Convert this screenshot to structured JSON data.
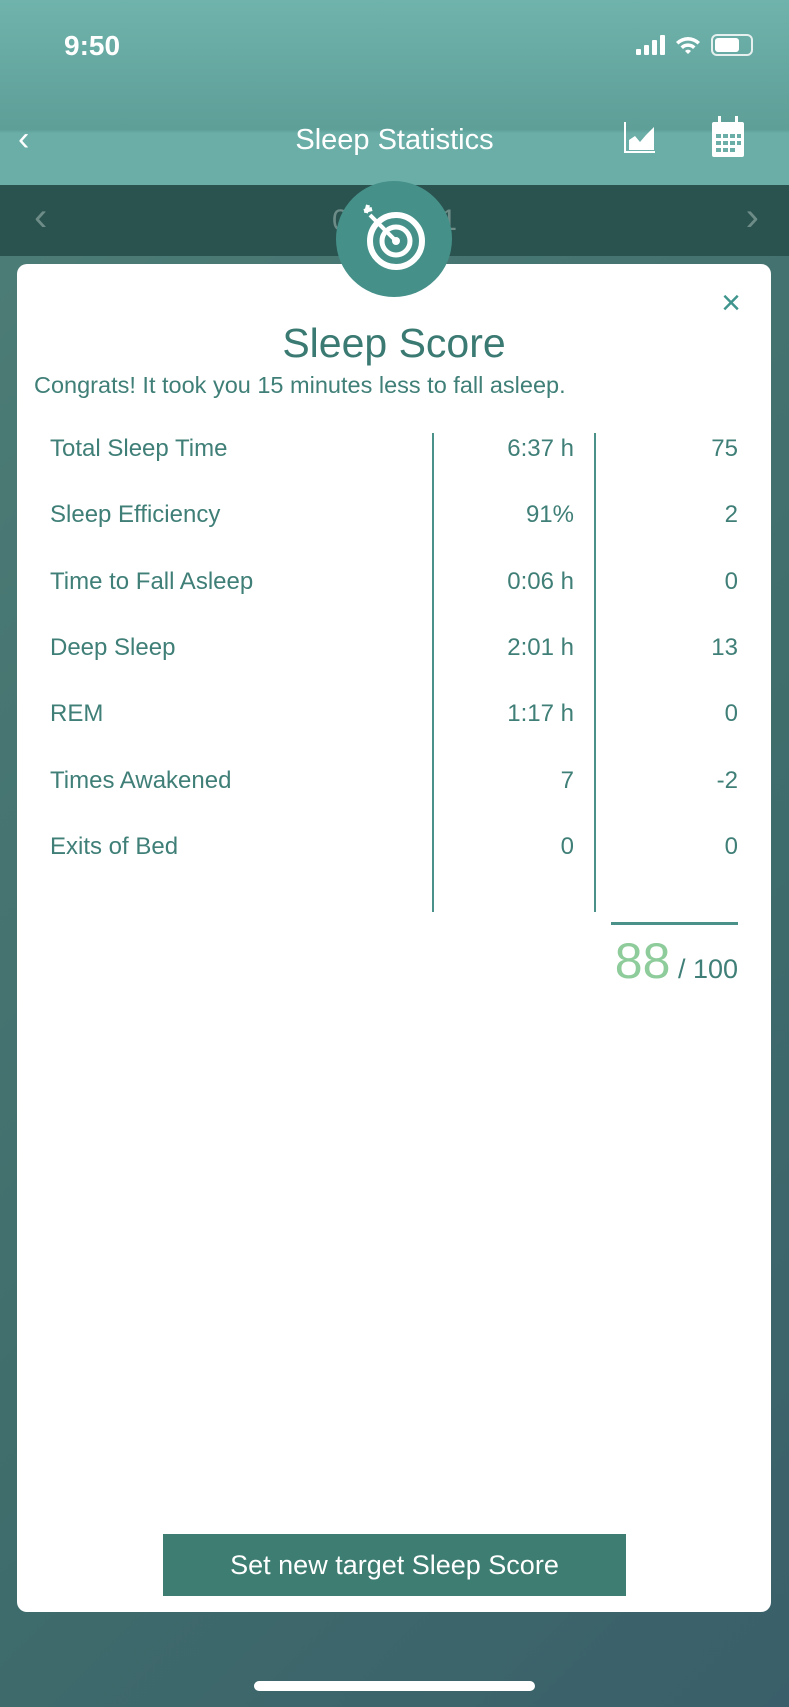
{
  "status_bar": {
    "time": "9:50"
  },
  "nav": {
    "title": "Sleep Statistics",
    "back_icon": "chevron-left",
    "chart_icon": "bar-chart",
    "calendar_icon": "calendar"
  },
  "date_bar": {
    "date": "06/  /2021"
  },
  "modal": {
    "icon": "target-dart",
    "title": "Sleep Score",
    "message": "Congrats! It took you 15 minutes less to fall asleep.",
    "rows": [
      {
        "label": "Total Sleep Time",
        "value": "6:37 h",
        "points": "75"
      },
      {
        "label": "Sleep Efficiency",
        "value": "91%",
        "points": "2"
      },
      {
        "label": "Time to Fall Asleep",
        "value": "0:06 h",
        "points": "0"
      },
      {
        "label": "Deep Sleep",
        "value": "2:01 h",
        "points": "13"
      },
      {
        "label": "REM",
        "value": "1:17 h",
        "points": "0"
      },
      {
        "label": "Times Awakened",
        "value": "7",
        "points": "-2"
      },
      {
        "label": "Exits of Bed",
        "value": "0",
        "points": "0"
      }
    ],
    "score": "88",
    "score_max": "/ 100",
    "button": "Set new target Sleep Score",
    "close": "×"
  },
  "colors": {
    "accent": "#45918a",
    "score": "#8fcc9b",
    "button": "#3e7d72"
  }
}
